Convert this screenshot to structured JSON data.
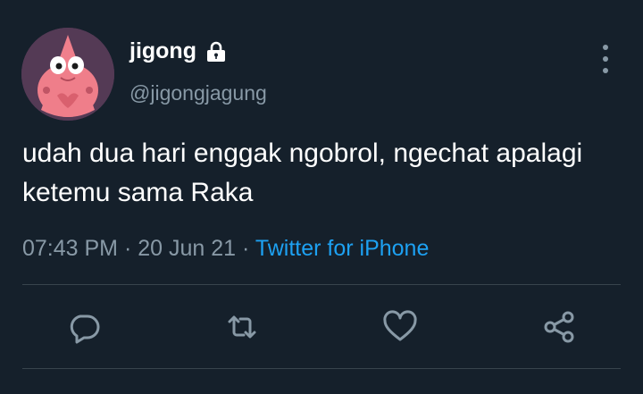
{
  "tweet": {
    "display_name": "jigong",
    "handle": "@jigongjagung",
    "text": "udah dua hari enggak ngobrol, ngechat apalagi ketemu sama Raka",
    "time": "07:43 PM",
    "separator1": " · ",
    "date": "20 Jun 21",
    "separator2": " · ",
    "source": "Twitter for iPhone"
  },
  "icons": {
    "lock": "lock-icon",
    "more": "more-vertical-icon",
    "reply": "reply-icon",
    "retweet": "retweet-icon",
    "like": "heart-icon",
    "share": "share-icon"
  },
  "colors": {
    "background": "#15202b",
    "text_primary": "#ffffff",
    "text_secondary": "#8899a6",
    "link": "#1da1f2",
    "divider": "#38444d"
  }
}
